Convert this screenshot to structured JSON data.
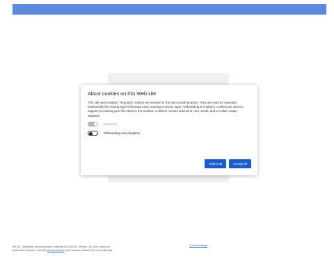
{
  "colors": {
    "accent": "#1a5bd0",
    "top_bar": "#5a8be0"
  },
  "dialog": {
    "title": "About cookies on this Web site",
    "body": "This site uses cookies. 'Required' cookies are needed for the site to work properly. They are used for essential functionality like storing login information and ensuring a secure login. 'Onboarding & Analytics' cookies are used to support you during your first steps in the product, to deliver content tailored to your needs, and to collect usage statistics.",
    "toggles": [
      {
        "label": "Required",
        "state": "on",
        "disabled": true
      },
      {
        "label": "Onboarding and analytics",
        "state": "off",
        "disabled": false
      }
    ],
    "reject_label": "Reject all",
    "accept_label": "Accept all"
  },
  "footer": {
    "line1": "are AG, Darmstadt, Germany and/or Software AG USA Inc., Reston, VA, USA, and/or its",
    "line2_prefix": "and/or their licensors. View the ",
    "privacy_link": "privacy policies",
    "line2_suffix": " of the various Software AG Cloud offerings.",
    "cookie_settings": "Cookie settings"
  }
}
